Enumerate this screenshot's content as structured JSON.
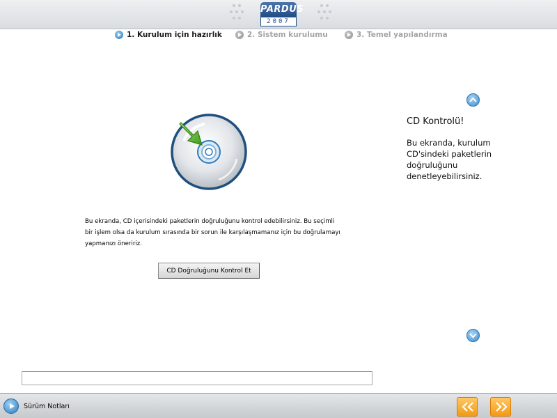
{
  "header": {
    "logo_brand": "PARDUS",
    "logo_year": "2007"
  },
  "steps": [
    {
      "label": "1. Kurulum için hazırlık",
      "state": "active"
    },
    {
      "label": "2. Sistem kurulumu",
      "state": "inactive"
    },
    {
      "label": "3. Temel yapılandırma",
      "state": "inactive"
    }
  ],
  "main": {
    "description": "Bu ekranda, CD içerisindeki paketlerin doğruluğunu kontrol edebilirsiniz. Bu seçimli bir işlem olsa da kurulum sırasında bir sorun ile karşılaşmamanız için bu doğrulamayı yapmanızı öneririz.",
    "check_button_label": "CD Doğruluğunu Kontrol Et",
    "progress_text": ""
  },
  "help": {
    "title": "CD Kontrolü!",
    "body": "Bu ekranda, kurulum CD'sindeki paketlerin doğruluğunu denetleyebilirsiniz."
  },
  "footer": {
    "release_notes_label": "Sürüm Notları"
  },
  "colors": {
    "accent_blue": "#2f7bbd",
    "nav_orange": "#f39a13",
    "cd_ring": "#1f4f7d"
  }
}
